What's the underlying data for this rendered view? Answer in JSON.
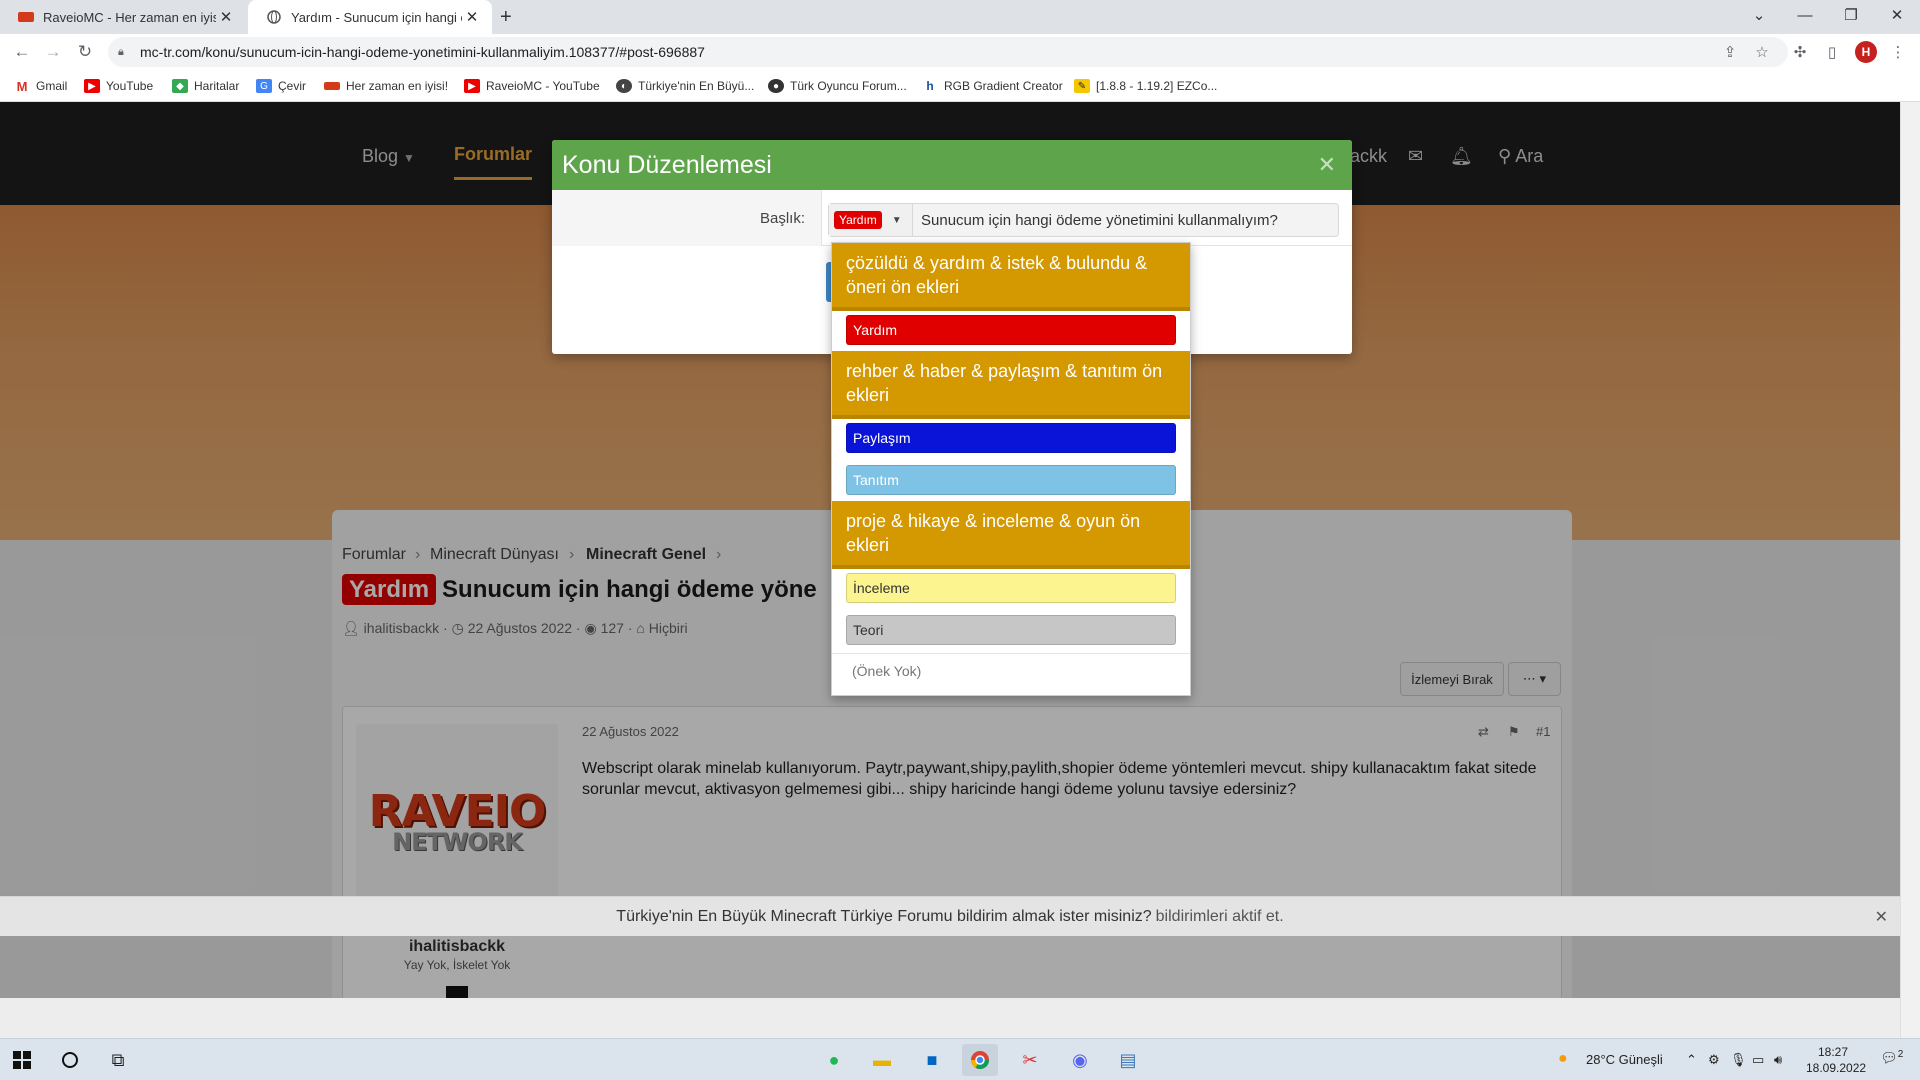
{
  "browser": {
    "tabs": [
      {
        "title": "RaveioMC - Her zaman en iyisi!",
        "active": false
      },
      {
        "title": "Yardım - Sunucum için hangi öde",
        "active": true
      }
    ],
    "new_tab": "+",
    "url": "mc-tr.com/konu/sunucum-icin-hangi-odeme-yonetimini-kullanmaliyim.108377/#post-696887",
    "profile_initial": "H",
    "bookmarks": [
      "Gmail",
      "YouTube",
      "Haritalar",
      "Çevir",
      "Her zaman en iyisi!",
      "RaveioMC - YouTube",
      "Türkiye'nin En Büyü...",
      "Türk Oyuncu Forum...",
      "RGB Gradient Creator",
      "[1.8.8 - 1.19.2] EZCo..."
    ]
  },
  "site": {
    "nav": {
      "blog": "Blog",
      "forums": "Forumlar",
      "user_fragment": "ackk",
      "search": "Ara"
    },
    "breadcrumb": [
      "Forumlar",
      "Minecraft Dünyası",
      "Minecraft Genel"
    ],
    "thread": {
      "prefix": "Yardım",
      "title": "Sunucum için hangi ödeme yöne",
      "author": "ihalitisbackk",
      "date": "22 Ağustos 2022",
      "views": "127",
      "tags": "Hiçbiri",
      "watch_label": "İzlemeyi Bırak",
      "more_label": "⋯ ▾"
    },
    "post": {
      "logo_main": "RAVEIO",
      "logo_sub": "NETWORK",
      "username": "ihalitisbackk",
      "user_title": "Yay Yok, İskelet Yok",
      "date": "22 Ağustos 2022",
      "number": "#1",
      "text": "Webscript olarak minelab kullanıyorum. Paytr,paywant,shipy,paylith,shopier ödeme yöntemleri mevcut. shipy kullanacaktım fakat sitede sorunlar mevcut, aktivasyon gelmemesi gibi... shipy haricinde hangi ödeme yolunu tavsiye edersiniz?"
    },
    "notice": {
      "text": "Türkiye'nin En Büyük Minecraft Türkiye Forumu bildirim almak ister misiniz?",
      "link": "bildirimleri aktif et."
    }
  },
  "modal": {
    "title": "Konu Düzenlemesi",
    "close": "✕",
    "title_label": "Başlık:",
    "selected_prefix": "Yardım",
    "title_value": "Sunucum için hangi ödeme yönetimini kullanmalıyım?"
  },
  "dropdown": {
    "groups": [
      "çözüldü & yardım & istek & bulundu & öneri ön ekleri",
      "rehber & haber & paylaşım & tanıtım ön ekleri",
      "proje & hikaye & inceleme & oyun ön ekleri"
    ],
    "options": [
      {
        "label": "Yardım",
        "color": "#e00000",
        "text_color": "#ffffff"
      },
      {
        "label": "Paylaşım",
        "color": "#0a14d8",
        "text_color": "#ffffff"
      },
      {
        "label": "Tanıtım",
        "color": "#7ec3e6",
        "text_color": "#ffffff"
      },
      {
        "label": "İnceleme",
        "color": "#fcf48f",
        "text_color": "#333333"
      },
      {
        "label": "Teori",
        "color": "#c6c6c6",
        "text_color": "#333333"
      }
    ],
    "none_label": "(Önek Yok)"
  },
  "taskbar": {
    "weather": "28°C Güneşli",
    "time": "18:27",
    "date": "18.09.2022",
    "notification_count": "2"
  },
  "colors": {
    "header_green": "#5ea44a",
    "group_gold": "#d49800",
    "prefix_red": "#e00000"
  }
}
